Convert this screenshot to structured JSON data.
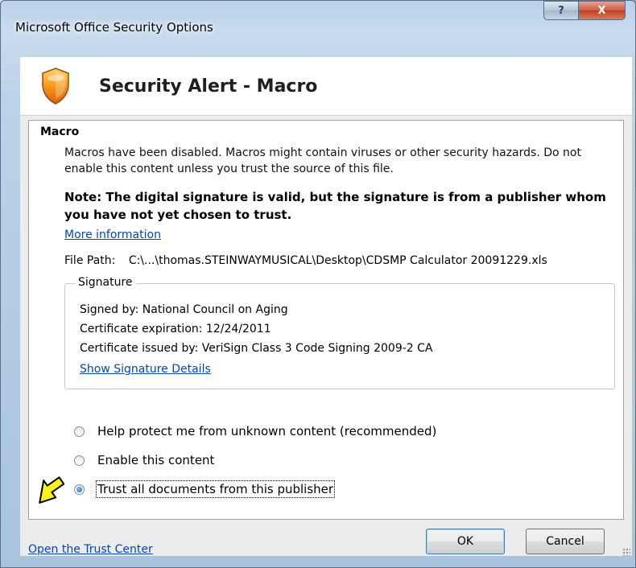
{
  "window": {
    "title": "Microsoft Office Security Options",
    "help_glyph": "?",
    "close_glyph": "X"
  },
  "header": {
    "title": "Security Alert - Macro",
    "icon": "shield-warning-icon"
  },
  "section": {
    "title": "Macro",
    "description": "Macros have been disabled. Macros might contain viruses or other security hazards. Do not enable this content unless you trust the source of this file.",
    "note": "Note: The digital signature is valid, but the signature is from a publisher whom you have not yet chosen to trust.",
    "more_info_link": "More information",
    "file_path_label": "File Path:",
    "file_path_value": "C:\\...\\thomas.STEINWAYMUSICAL\\Desktop\\CDSMP Calculator 20091229.xls"
  },
  "signature": {
    "legend": "Signature",
    "signed_by": "Signed by: National Council on Aging",
    "expiration": "Certificate expiration: 12/24/2011",
    "issued_by": "Certificate issued by: VeriSign Class 3 Code Signing 2009-2 CA",
    "details_link": "Show Signature Details"
  },
  "options": {
    "items": [
      {
        "label": "Help protect me from unknown content (recommended)",
        "selected": false
      },
      {
        "label": "Enable this content",
        "selected": false
      },
      {
        "label": "Trust all documents from this publisher",
        "selected": true
      }
    ]
  },
  "footer": {
    "trust_center_link": "Open the Trust Center",
    "ok_label": "OK",
    "cancel_label": "Cancel"
  },
  "colors": {
    "link": "#0645ad",
    "arrow_fill": "#f7f21a",
    "shield_orange": "#f39a1f"
  }
}
